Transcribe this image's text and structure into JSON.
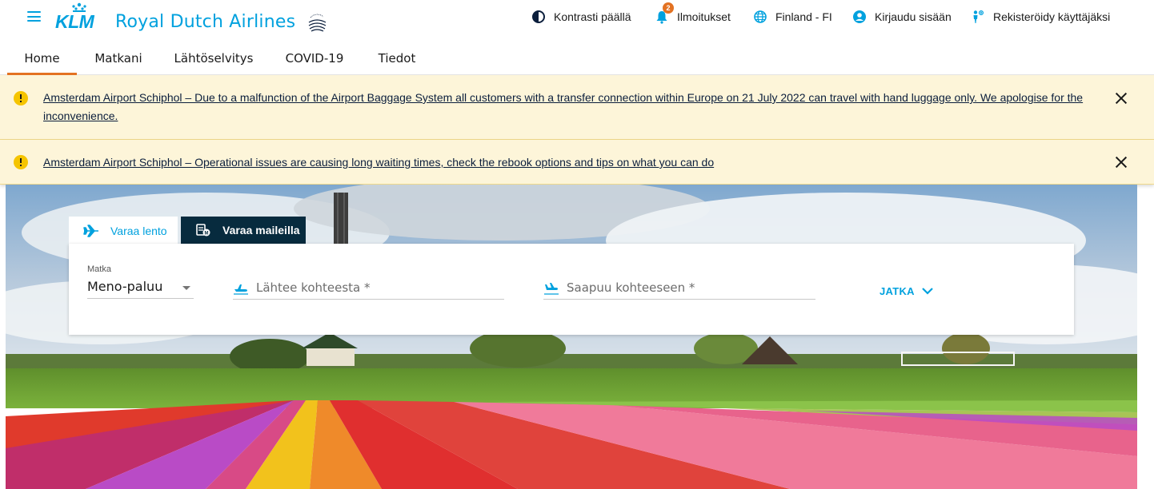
{
  "header": {
    "logo_mark": "KLM",
    "brand_name": "Royal Dutch Airlines",
    "skyteam_logo": "SKYTEAM",
    "utilities": [
      {
        "label": "Kontrasti päällä",
        "icon": "contrast-icon"
      },
      {
        "label": "Ilmoitukset",
        "icon": "bell-icon",
        "badge": "2"
      },
      {
        "label": "Finland - FI",
        "icon": "globe-icon"
      },
      {
        "label": "Kirjaudu sisään",
        "icon": "account-icon"
      },
      {
        "label": "Rekisteröidy käyttäjäksi",
        "icon": "register-person-icon"
      }
    ]
  },
  "nav": {
    "tabs": [
      {
        "label": "Home",
        "active": true
      },
      {
        "label": "Matkani",
        "active": false
      },
      {
        "label": "Lähtöselvitys",
        "active": false
      },
      {
        "label": "COVID-19",
        "active": false
      },
      {
        "label": "Tiedot",
        "active": false
      }
    ]
  },
  "alerts": [
    {
      "text": "Amsterdam Airport Schiphol – Due to a malfunction of the Airport Baggage System all customers with a transfer connection within Europe on 21 July 2022 can travel with hand luggage only. We apologise for the inconvenience.",
      "icon": "warning-icon"
    },
    {
      "text": "Amsterdam Airport Schiphol – Operational issues are causing long waiting times, check the rebook options and tips on what you can do",
      "icon": "warning-icon"
    }
  ],
  "booking": {
    "tabs": [
      {
        "label": "Varaa lento",
        "icon": "plane-icon",
        "active": true
      },
      {
        "label": "Varaa maileilla",
        "icon": "miles-icon",
        "active": false
      }
    ],
    "trip_label": "Matka",
    "trip_value": "Meno-paluu",
    "from_placeholder": "Lähtee kohteesta *",
    "to_placeholder": "Saapuu kohteeseen *",
    "continue_label": "JATKA"
  },
  "colors": {
    "brand_blue": "#00a1de",
    "active_tab_underline": "#e37222",
    "alert_background": "#fdf5d9",
    "alert_icon": "#f5c400",
    "dark_tab": "#072b3e"
  }
}
